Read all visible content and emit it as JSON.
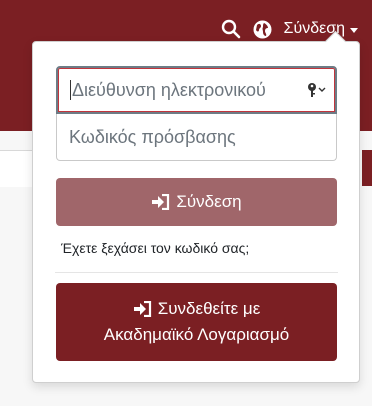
{
  "header": {
    "login_label": "Σύνδεση",
    "search_icon": "search-icon",
    "globe_icon": "globe-icon"
  },
  "login_form": {
    "email_placeholder": "Διεύθυνση ηλεκτρονικού",
    "password_placeholder": "Κωδικός πρόσβασης",
    "submit_label": "Σύνδεση",
    "forgot_password": "Έχετε ξεχάσει τον κωδικό σας;",
    "academic_line1": "Συνδεθείτε με",
    "academic_line2": "Ακαδημαϊκό Λογαριασμό"
  },
  "colors": {
    "brand": "#7b1f23",
    "submit_disabled": "#a0666a",
    "focus_ring": "#c2343c"
  }
}
